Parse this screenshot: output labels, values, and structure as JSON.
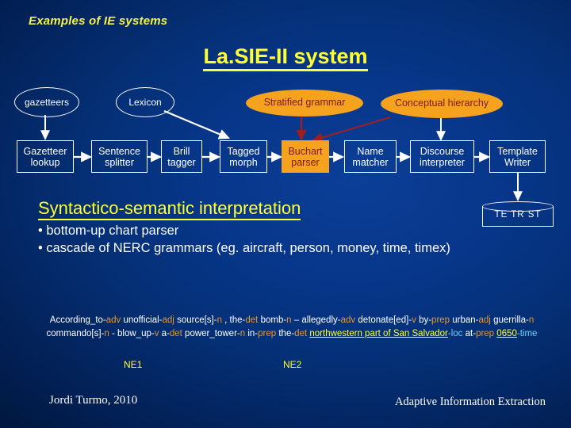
{
  "slide": {
    "kicker": "Examples of IE systems",
    "title": "La.SIE-II system"
  },
  "pipeline": {
    "sources": [
      {
        "label": "gazetteers",
        "style": "open"
      },
      {
        "label": "Lexicon",
        "style": "open"
      },
      {
        "label": "Stratified grammar",
        "style": "orange"
      },
      {
        "label": "Conceptual hierarchy",
        "style": "orange"
      }
    ],
    "stages": [
      {
        "label_line1": "Gazetteer",
        "label_line2": "lookup"
      },
      {
        "label_line1": "Sentence",
        "label_line2": "splitter"
      },
      {
        "label_line1": "Brill",
        "label_line2": "tagger"
      },
      {
        "label_line1": "Tagged",
        "label_line2": "morph"
      },
      {
        "label_line1": "Buchart",
        "label_line2": "parser"
      },
      {
        "label_line1": "Name",
        "label_line2": "matcher"
      },
      {
        "label_line1": "Discourse",
        "label_line2": "interpreter"
      },
      {
        "label_line1": "Template",
        "label_line2": "Writer"
      }
    ],
    "store": {
      "label": "TE  TR  ST"
    }
  },
  "section": {
    "heading": "Syntactico-semantic interpretation",
    "bullets": [
      "• bottom-up chart parser",
      "• cascade of NERC grammars (eg. aircraft, person, money, time, timex)"
    ]
  },
  "sample": {
    "tokens": [
      {
        "t": "According_to-",
        "c": "w"
      },
      {
        "t": "adv",
        "c": "pos"
      },
      {
        "t": " unofficial-",
        "c": "w"
      },
      {
        "t": "adj",
        "c": "pos"
      },
      {
        "t": " source[s]-",
        "c": "w"
      },
      {
        "t": "n",
        "c": "pos"
      },
      {
        "t": " , the-",
        "c": "w"
      },
      {
        "t": "det",
        "c": "pos"
      },
      {
        "t": " bomb-",
        "c": "w"
      },
      {
        "t": "n",
        "c": "pos"
      },
      {
        "t": " – allegedly-",
        "c": "w"
      },
      {
        "t": "adv",
        "c": "pos"
      },
      {
        "t": " detonate[ed]-",
        "c": "w"
      },
      {
        "t": "v",
        "c": "pos"
      },
      {
        "t": " by-",
        "c": "w"
      },
      {
        "t": "prep",
        "c": "pos"
      },
      {
        "t": " urban-",
        "c": "w"
      },
      {
        "t": "adj",
        "c": "pos"
      },
      {
        "t": " guerrilla-",
        "c": "w"
      },
      {
        "t": "n",
        "c": "pos"
      },
      {
        "t": " commando[s]-",
        "c": "w"
      },
      {
        "t": "n",
        "c": "pos"
      },
      {
        "t": " - blow_up-",
        "c": "w"
      },
      {
        "t": "v",
        "c": "pos"
      },
      {
        "t": " a-",
        "c": "w"
      },
      {
        "t": "det",
        "c": "pos"
      },
      {
        "t": " power_tower-",
        "c": "w"
      },
      {
        "t": "n",
        "c": "pos"
      },
      {
        "t": " in-",
        "c": "w"
      },
      {
        "t": "prep",
        "c": "pos"
      },
      {
        "t": " the-",
        "c": "w"
      },
      {
        "t": "det",
        "c": "pos"
      },
      {
        "t": " ",
        "c": "w"
      },
      {
        "t": "northwestern part of San Salvador",
        "c": "ne"
      },
      {
        "t": "-loc",
        "c": "loc"
      },
      {
        "t": " at-",
        "c": "w"
      },
      {
        "t": "prep",
        "c": "pos"
      },
      {
        "t": " ",
        "c": "w"
      },
      {
        "t": "0650",
        "c": "ne"
      },
      {
        "t": "-time",
        "c": "loc"
      }
    ],
    "ne_labels": [
      {
        "text": "NE1"
      },
      {
        "text": "NE2"
      }
    ]
  },
  "footer": {
    "left": "Jordi Turmo, 2010",
    "right": "Adaptive Information Extraction"
  },
  "colors": {
    "background_deep": "#011336",
    "background_bright": "#0b3f97",
    "accent_yellow": "#ffff33",
    "accent_orange": "#f5a21e",
    "arrow_red": "#9e1f1f",
    "text_white": "#ffffff"
  }
}
